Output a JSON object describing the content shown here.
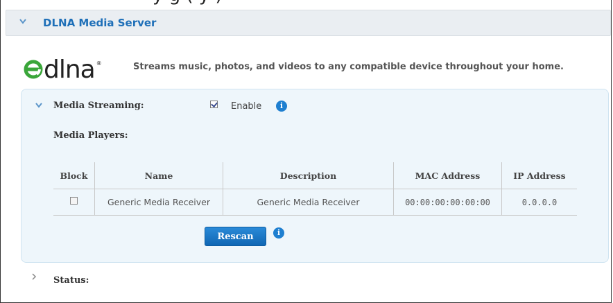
{
  "partial_top_text": "y            g (                       y   )",
  "header": {
    "title": "DLNA Media Server",
    "chevron_icon": "chevron-down-icon"
  },
  "logo": {
    "text": "dlna",
    "reg": "®"
  },
  "tagline": "Streams music, photos, and videos to any compatible device throughout your home.",
  "media_streaming": {
    "label": "Media Streaming:",
    "enabled": true,
    "enable_label": "Enable",
    "info_icon": "info-icon"
  },
  "media_players": {
    "label": "Media Players:",
    "columns": [
      "Block",
      "Name",
      "Description",
      "MAC Address",
      "IP Address"
    ],
    "rows": [
      {
        "block": false,
        "name": "Generic Media Receiver",
        "description": "Generic Media Receiver",
        "mac": "00:00:00:00:00:00",
        "ip": "0.0.0.0"
      }
    ]
  },
  "rescan": {
    "label": "Rescan",
    "info_icon": "info-icon"
  },
  "status": {
    "label": "Status:",
    "chevron_icon": "chevron-right-icon"
  },
  "colors": {
    "accent": "#1e6fb8",
    "button": "#1470c0",
    "panel_bg": "#eef6fb",
    "header_bg": "#eaeef2"
  }
}
